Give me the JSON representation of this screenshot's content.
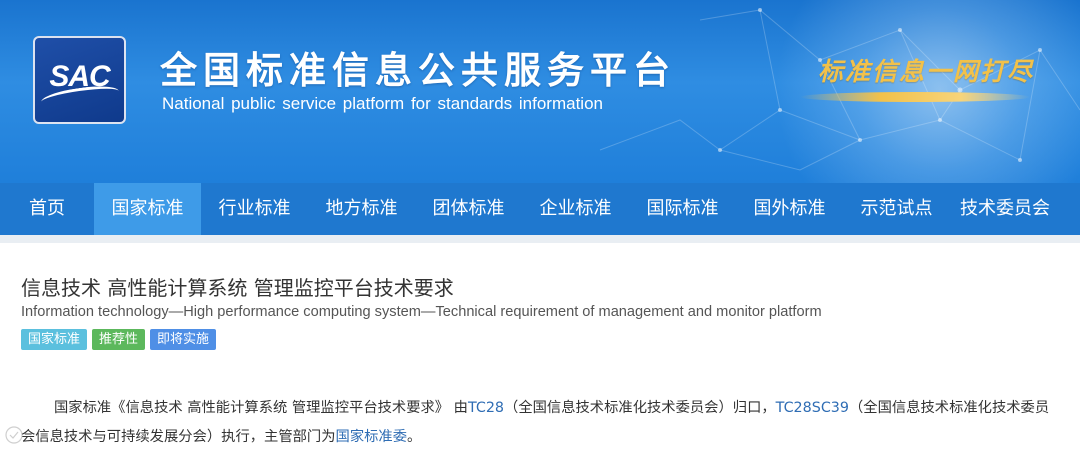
{
  "header": {
    "logo_text": "SAC",
    "title_cn": "全国标准信息公共服务平台",
    "title_en": "National public service platform  for standards information",
    "slogan": "标准信息一网打尽"
  },
  "nav": {
    "items": [
      {
        "label": "首页",
        "active": false
      },
      {
        "label": "国家标准",
        "active": true
      },
      {
        "label": "行业标准",
        "active": false
      },
      {
        "label": "地方标准",
        "active": false
      },
      {
        "label": "团体标准",
        "active": false
      },
      {
        "label": "企业标准",
        "active": false
      },
      {
        "label": "国际标准",
        "active": false
      },
      {
        "label": "国外标准",
        "active": false
      },
      {
        "label": "示范试点",
        "active": false
      },
      {
        "label": "技术委员会",
        "active": false
      }
    ]
  },
  "standard": {
    "title_cn": "信息技术 高性能计算系统 管理监控平台技术要求",
    "title_en": "Information technology—High performance computing system—Technical requirement of management and monitor platform",
    "tags": [
      "国家标准",
      "推荐性",
      "即将实施"
    ],
    "desc": {
      "part1": "国家标准《信息技术 高性能计算系统 管理监控平台技术要求》 由",
      "tc_link": "TC28",
      "part2": "（全国信息技术标准化技术委员会）归口，",
      "sc_link": "TC28SC39",
      "part3": "（全国信息技术标准化技术委员会信息技术与可持续发展分会）执行，主管部门为",
      "dept_link": "国家标准委",
      "part4": "。"
    }
  },
  "colors": {
    "banner": "#2f8de2",
    "nav": "#1f78cf",
    "nav_active": "#3e9be8",
    "slogan": "#f2c14a",
    "tag_national": "#5bc0de",
    "tag_recommended": "#5cb85c",
    "tag_upcoming": "#4f8fe6",
    "link": "#2f6db4"
  }
}
